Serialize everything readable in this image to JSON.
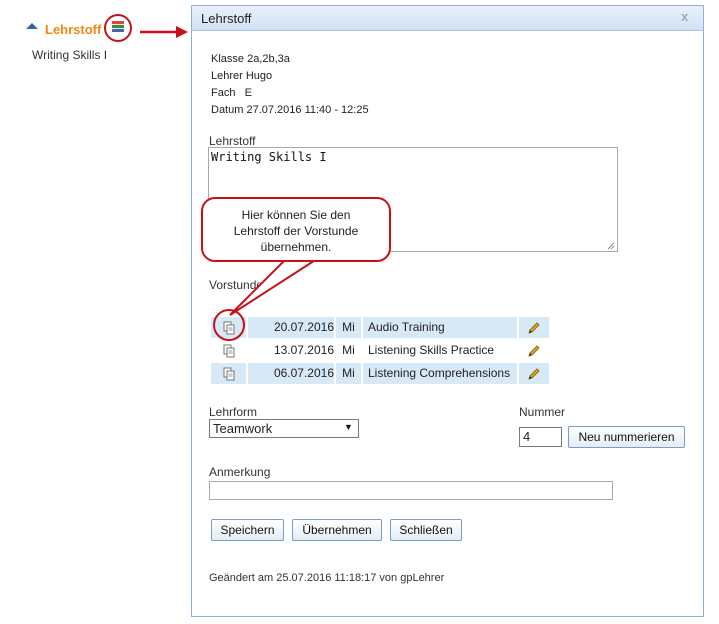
{
  "sidebar": {
    "section_label": "Lehrstoff",
    "item": "Writing Skills I",
    "icons": {
      "expand": "triangle-up-icon",
      "book": "books-icon"
    }
  },
  "dialog": {
    "title": "Lehrstoff",
    "close_label": "x",
    "info": {
      "klasse": "Klasse 2a,2b,3a",
      "lehrer": "Lehrer Hugo",
      "fach": "Fach   E",
      "datum": "Datum 27.07.2016 11:40 - 12:25"
    },
    "lehrstoff_label": "Lehrstoff",
    "lehrstoff_value": "Writing Skills I",
    "vorstunden_label": "Vorstunden",
    "vorstunden": [
      {
        "date": "20.07.2016",
        "day": "Mi",
        "title": "Audio Training"
      },
      {
        "date": "13.07.2016",
        "day": "Mi",
        "title": "Listening Skills Practice"
      },
      {
        "date": "06.07.2016",
        "day": "Mi",
        "title": "Listening Comprehensions"
      }
    ],
    "lehrform_label": "Lehrform",
    "lehrform_value": "Teamwork",
    "nummer_label": "Nummer",
    "nummer_value": "4",
    "renumber_button": "Neu nummerieren",
    "anmerkung_label": "Anmerkung",
    "anmerkung_value": "",
    "buttons": {
      "save": "Speichern",
      "apply": "Übernehmen",
      "close": "Schließen"
    },
    "footer": "Geändert am 25.07.2016 11:18:17 von gpLehrer"
  },
  "callout": {
    "text_line1": "Hier können Sie den",
    "text_line2": "Lehrstoff der Vorstunde",
    "text_line3": "übernehmen."
  },
  "colors": {
    "annotation": "#c8101a",
    "link": "#f0890e",
    "row_highlight": "#d7e8f7"
  }
}
